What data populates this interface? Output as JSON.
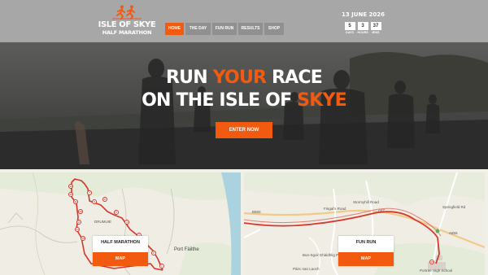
{
  "logo": {
    "line1": "ISLE OF SKYE",
    "line2": "HALF MARATHON"
  },
  "nav": {
    "items": [
      {
        "label": "HOME",
        "active": true
      },
      {
        "label": "THE DAY",
        "active": false
      },
      {
        "label": "FUN RUN",
        "active": false
      },
      {
        "label": "RESULTS",
        "active": false
      },
      {
        "label": "SHOP",
        "active": false
      }
    ]
  },
  "countdown": {
    "date": "13 JUNE 2026",
    "units": [
      {
        "value": "5",
        "label": "DAYS"
      },
      {
        "value": "3",
        "label": "HOURS"
      },
      {
        "value": "37",
        "label": "MINS"
      }
    ]
  },
  "hero": {
    "line1_pre": "RUN ",
    "line1_accent": "YOUR",
    "line1_post": " RACE",
    "line2_pre": "ON THE ISLE OF ",
    "line2_accent": "SKYE",
    "cta_label": "ENTER NOW"
  },
  "maps": {
    "half": {
      "title": "HALF MARATHON",
      "button": "MAP",
      "place_drumuie": "DRUMUIE",
      "place_portree": "Port Fàilthe",
      "markers": [
        "13",
        "12",
        "11",
        "10",
        "9",
        "14",
        "15",
        "8",
        "7",
        "6",
        "5",
        "4",
        "3",
        "2",
        "1"
      ]
    },
    "fun": {
      "title": "FUN RUN",
      "button": "MAP",
      "labels": {
        "school": "Portree High School",
        "loch": "Pàirc nan Laoch",
        "bun": "Bun-Sgoil Ghàidhlig Phort Rìgh",
        "a87": "A87",
        "a855": "A855",
        "b883": "B883",
        "fingal": "Fingal's Road",
        "stormyhill": "Stormyhill Road",
        "springfield": "Springfield Rd"
      },
      "marker": "15"
    }
  },
  "colors": {
    "accent": "#f25a0f",
    "header_bg": "#a7a7a7",
    "nav_bg": "#909090",
    "route": "#d6372b"
  }
}
